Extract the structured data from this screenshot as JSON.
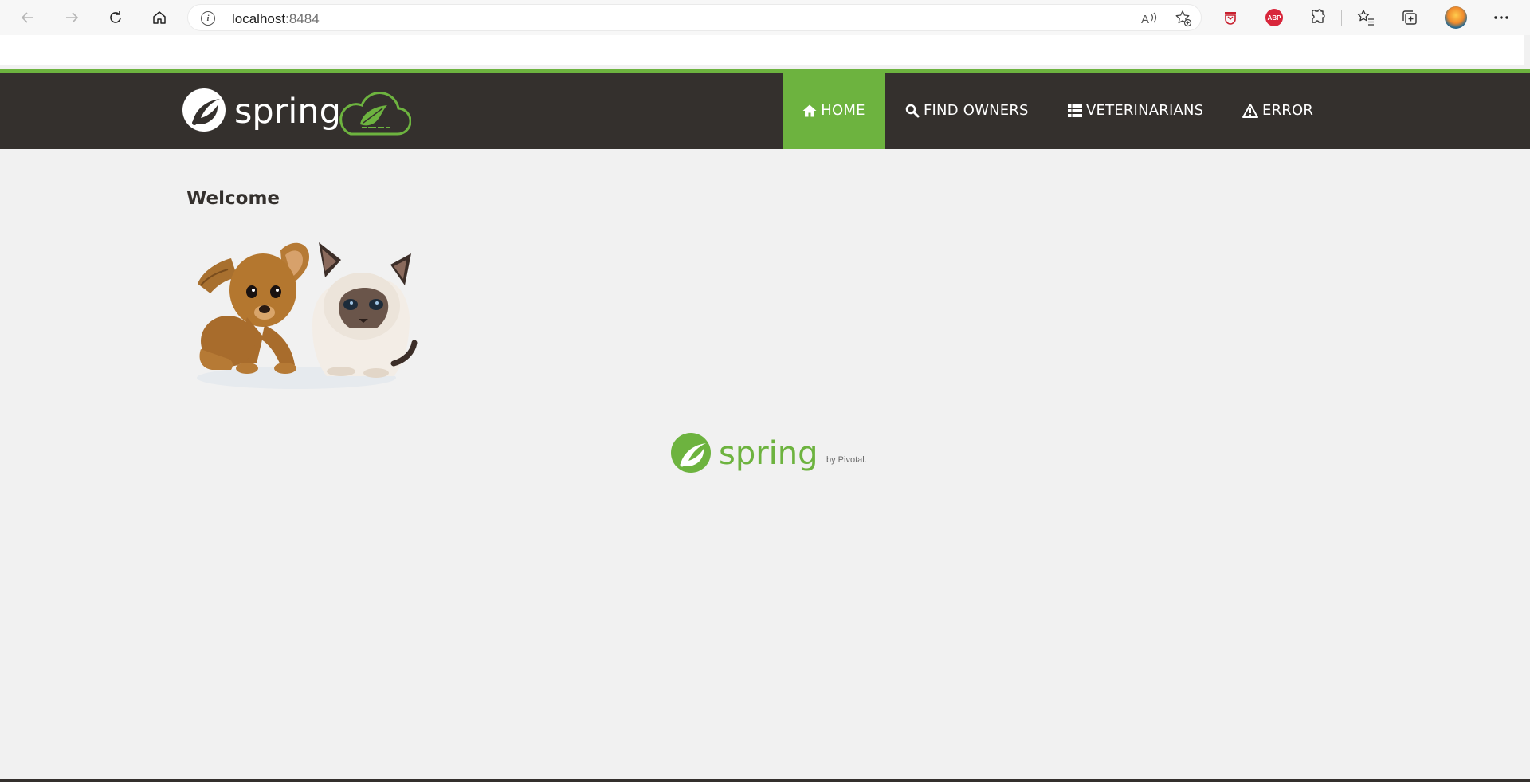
{
  "browser": {
    "url_host": "localhost",
    "url_port": ":8484",
    "icons": [
      "back-icon",
      "forward-icon",
      "refresh-icon",
      "home-icon",
      "info-icon",
      "read-aloud-icon",
      "favorite-add-icon",
      "extension-icon",
      "adblock-icon",
      "puzzle-icon",
      "favorites-icon",
      "collections-icon",
      "profile-avatar",
      "more-icon"
    ],
    "abp_label": "ABP"
  },
  "header": {
    "brand_text": "spring",
    "nav": [
      {
        "label": "HOME",
        "icon": "home-icon",
        "active": true
      },
      {
        "label": "FIND OWNERS",
        "icon": "search-icon",
        "active": false
      },
      {
        "label": "VETERINARIANS",
        "icon": "list-icon",
        "active": false
      },
      {
        "label": "ERROR",
        "icon": "warning-icon",
        "active": false
      }
    ]
  },
  "main": {
    "heading": "Welcome",
    "image_alt": "puppy and kitten"
  },
  "footer": {
    "brand_text": "spring",
    "by_text": "by Pivotal."
  },
  "colors": {
    "spring_green": "#6db33f",
    "navbar_dark": "#34302d",
    "page_bg": "#f1f1f1"
  }
}
